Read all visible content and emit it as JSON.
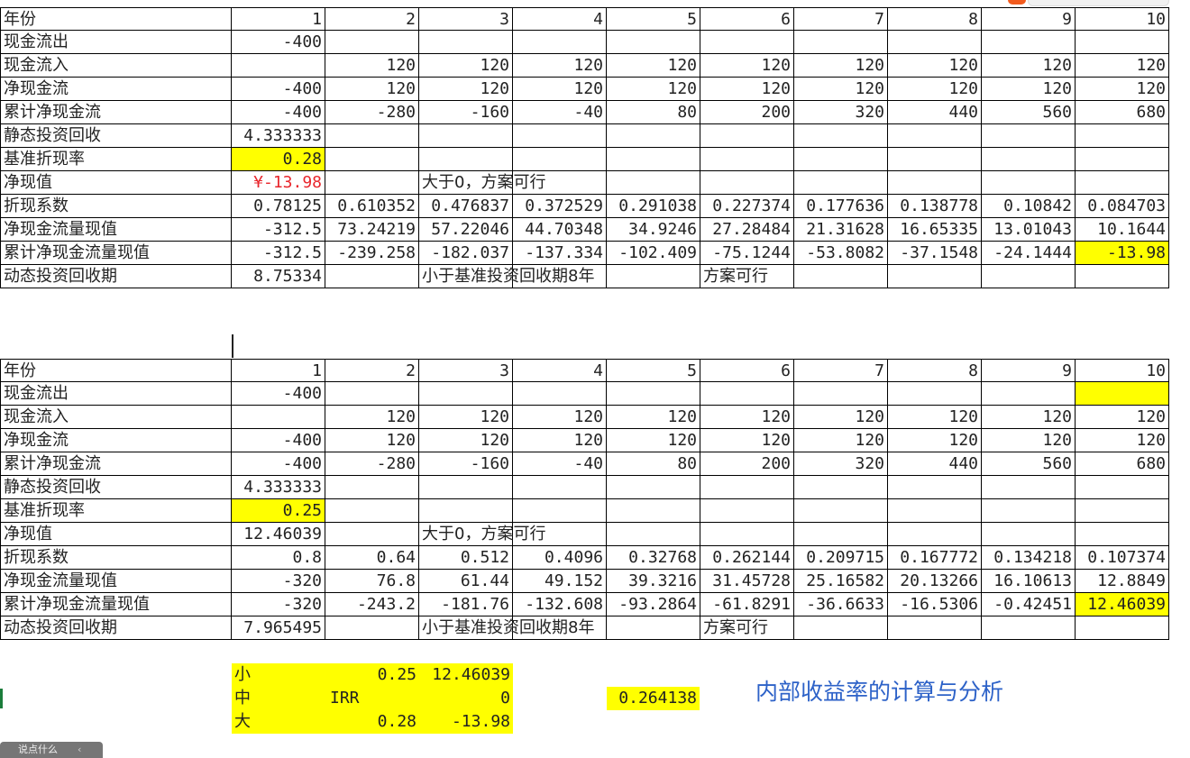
{
  "top_bar": {
    "brand_color": "#f25b1e"
  },
  "section1": {
    "rows": [
      {
        "name": "year-row",
        "label": "年份",
        "values": [
          "1",
          "2",
          "3",
          "4",
          "5",
          "6",
          "7",
          "8",
          "9",
          "10"
        ]
      },
      {
        "name": "cash-outflow-row",
        "label": "现金流出",
        "values": [
          "-400",
          "",
          "",
          "",
          "",
          "",
          "",
          "",
          "",
          ""
        ]
      },
      {
        "name": "cash-inflow-row",
        "label": "现金流入",
        "values": [
          "",
          "120",
          "120",
          "120",
          "120",
          "120",
          "120",
          "120",
          "120",
          "120"
        ]
      },
      {
        "name": "net-cash-flow-row",
        "label": "净现金流",
        "values": [
          "-400",
          "120",
          "120",
          "120",
          "120",
          "120",
          "120",
          "120",
          "120",
          "120"
        ]
      },
      {
        "name": "cumulative-net-cash-flow-row",
        "label": "累计净现金流",
        "values": [
          "-400",
          "-280",
          "-160",
          "-40",
          "80",
          "200",
          "320",
          "440",
          "560",
          "680"
        ]
      },
      {
        "name": "static-payback-row",
        "label": "静态投资回收",
        "values": [
          "4.333333",
          "",
          "",
          "",
          "",
          "",
          "",
          "",
          "",
          ""
        ]
      },
      {
        "name": "discount-rate-row",
        "label": "基准折现率",
        "values": [
          "0.28",
          "",
          "",
          "",
          "",
          "",
          "",
          "",
          "",
          ""
        ]
      },
      {
        "name": "npv-row",
        "label": "净现值",
        "values": [
          "¥-13.98",
          "",
          "大于0，方案可行",
          "",
          "",
          "",
          "",
          "",
          "",
          ""
        ]
      },
      {
        "name": "discount-factor-row",
        "label": "折现系数",
        "values": [
          "0.78125",
          "0.610352",
          "0.476837",
          "0.372529",
          "0.291038",
          "0.227374",
          "0.177636",
          "0.138778",
          "0.10842",
          "0.084703"
        ]
      },
      {
        "name": "pv-net-cash-flow-row",
        "label": "净现金流量现值",
        "values": [
          "-312.5",
          "73.24219",
          "57.22046",
          "44.70348",
          "34.9246",
          "27.28484",
          "21.31628",
          "16.65335",
          "13.01043",
          "10.1644"
        ]
      },
      {
        "name": "cumulative-pv-row",
        "label": "累计净现金流量现值",
        "values": [
          "-312.5",
          "-239.258",
          "-182.037",
          "-137.334",
          "-102.409",
          "-75.1244",
          "-53.8082",
          "-37.1548",
          "-24.1444",
          "-13.98"
        ]
      },
      {
        "name": "dynamic-payback-row",
        "label": "动态投资回收期",
        "values": [
          "8.75334",
          "",
          "小于基准投资回收期8年",
          "",
          "",
          "方案可行",
          "",
          "",
          "",
          ""
        ]
      }
    ]
  },
  "section2": {
    "rows": [
      {
        "name": "year-row",
        "label": "年份",
        "values": [
          "1",
          "2",
          "3",
          "4",
          "5",
          "6",
          "7",
          "8",
          "9",
          "10"
        ]
      },
      {
        "name": "cash-outflow-row",
        "label": "现金流出",
        "values": [
          "-400",
          "",
          "",
          "",
          "",
          "",
          "",
          "",
          "",
          ""
        ]
      },
      {
        "name": "cash-inflow-row",
        "label": "现金流入",
        "values": [
          "",
          "120",
          "120",
          "120",
          "120",
          "120",
          "120",
          "120",
          "120",
          "120"
        ]
      },
      {
        "name": "net-cash-flow-row",
        "label": "净现金流",
        "values": [
          "-400",
          "120",
          "120",
          "120",
          "120",
          "120",
          "120",
          "120",
          "120",
          "120"
        ]
      },
      {
        "name": "cumulative-net-cash-flow-row",
        "label": "累计净现金流",
        "values": [
          "-400",
          "-280",
          "-160",
          "-40",
          "80",
          "200",
          "320",
          "440",
          "560",
          "680"
        ]
      },
      {
        "name": "static-payback-row",
        "label": "静态投资回收",
        "values": [
          "4.333333",
          "",
          "",
          "",
          "",
          "",
          "",
          "",
          "",
          ""
        ]
      },
      {
        "name": "discount-rate-row",
        "label": "基准折现率",
        "values": [
          "0.25",
          "",
          "",
          "",
          "",
          "",
          "",
          "",
          "",
          ""
        ]
      },
      {
        "name": "npv-row",
        "label": "净现值",
        "values": [
          "12.46039",
          "",
          "大于0，方案可行",
          "",
          "",
          "",
          "",
          "",
          "",
          ""
        ]
      },
      {
        "name": "discount-factor-row",
        "label": "折现系数",
        "values": [
          "0.8",
          "0.64",
          "0.512",
          "0.4096",
          "0.32768",
          "0.262144",
          "0.209715",
          "0.167772",
          "0.134218",
          "0.107374"
        ]
      },
      {
        "name": "pv-net-cash-flow-row",
        "label": "净现金流量现值",
        "values": [
          "-320",
          "76.8",
          "61.44",
          "49.152",
          "39.3216",
          "31.45728",
          "25.16582",
          "20.13266",
          "16.10613",
          "12.8849"
        ]
      },
      {
        "name": "cumulative-pv-row",
        "label": "累计净现金流量现值",
        "values": [
          "-320",
          "-243.2",
          "-181.76",
          "-132.608",
          "-93.2864",
          "-61.8291",
          "-36.6633",
          "-16.5306",
          "-0.42451",
          "12.46039"
        ]
      },
      {
        "name": "dynamic-payback-row",
        "label": "动态投资回收期",
        "values": [
          "7.965495",
          "",
          "小于基准投资回收期8年",
          "",
          "",
          "方案可行",
          "",
          "",
          "",
          ""
        ]
      }
    ]
  },
  "irr": {
    "rows": [
      {
        "label": "小",
        "rate": "0.25",
        "npv": "12.46039"
      },
      {
        "label": "中",
        "mid": "IRR",
        "npv": "0"
      },
      {
        "label": "大",
        "rate": "0.28",
        "npv": "-13.98"
      }
    ],
    "result": "0.264138",
    "title": "内部收益率的计算与分析"
  },
  "colors": {
    "highlight": "#ffff00",
    "negative_currency": "#e8262c",
    "title_blue": "#2d62c8",
    "gridline": "#000000"
  },
  "status_bar": {
    "text": "说点什么",
    "arrow": "‹"
  }
}
